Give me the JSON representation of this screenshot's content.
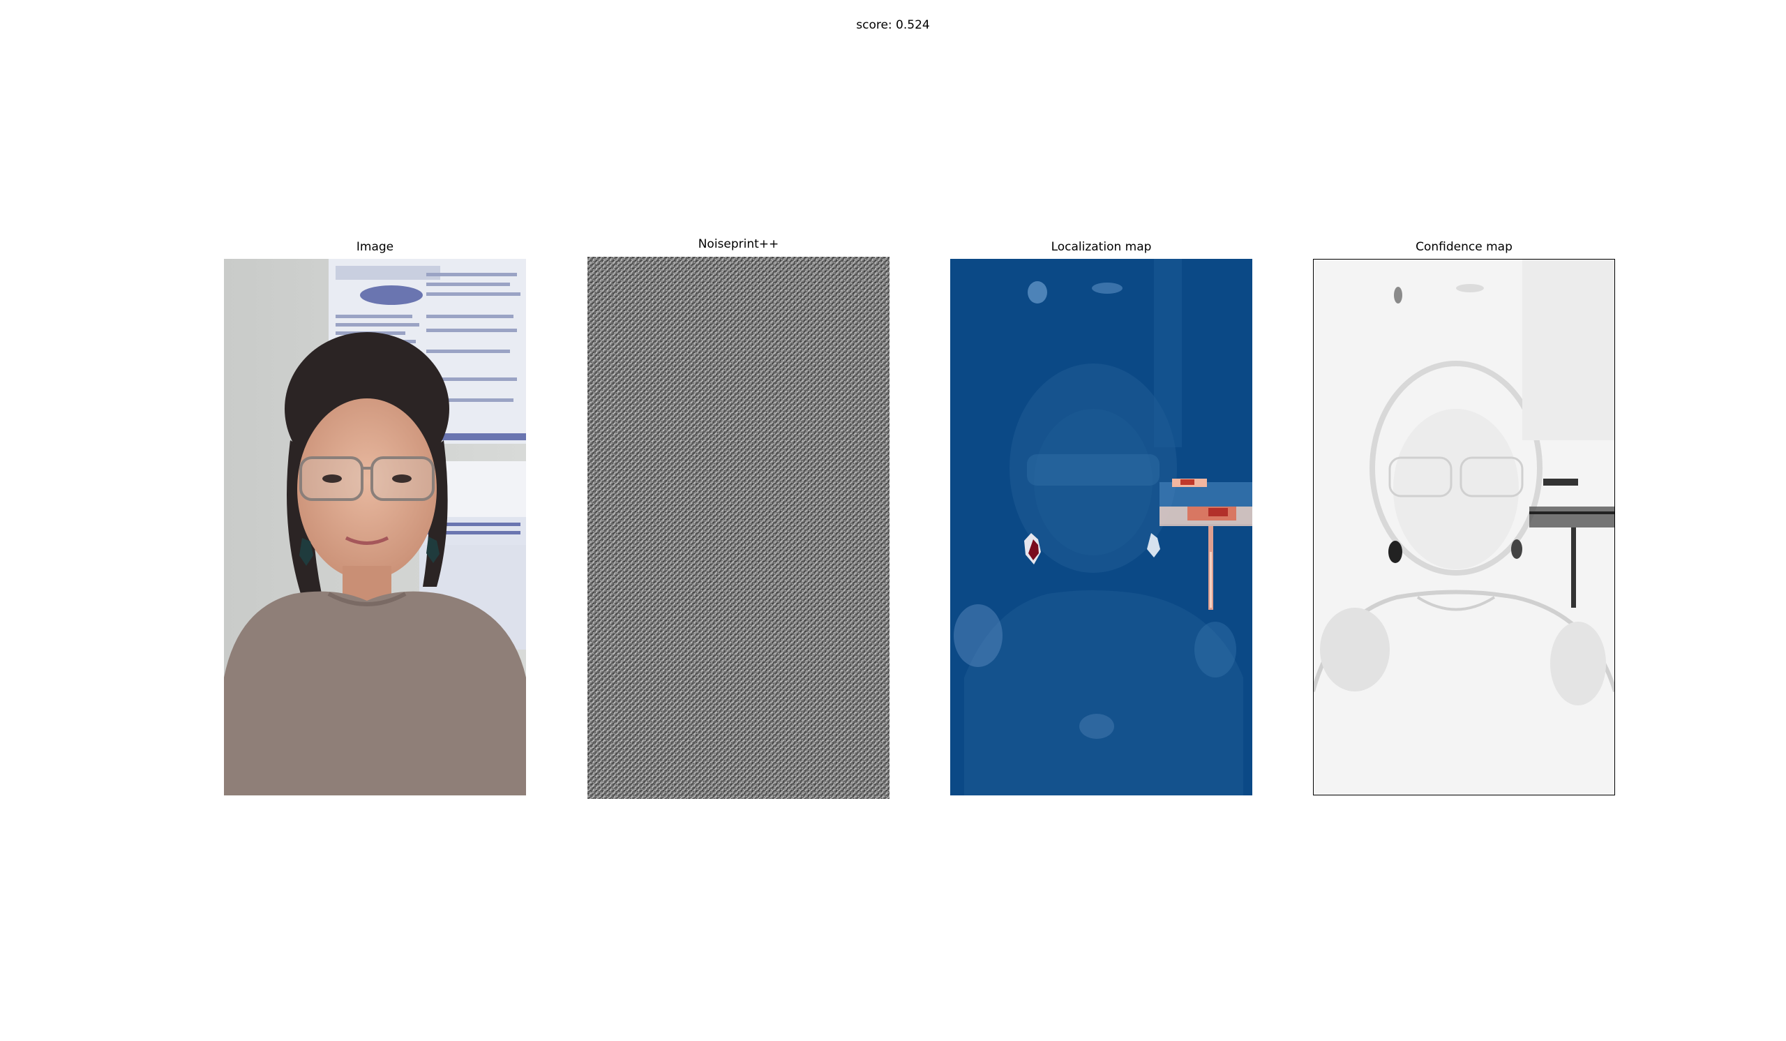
{
  "figure": {
    "score_text": "score: 0.524"
  },
  "panels": [
    {
      "title": "Image"
    },
    {
      "title": "Noiseprint++"
    },
    {
      "title": "Localization map"
    },
    {
      "title": "Confidence map"
    }
  ],
  "colors": {
    "background": "#ffffff",
    "localization_base": "#0d4d8c",
    "localization_hot": "#c0392b",
    "localization_peak": "#7a0b1f",
    "noise_gray": "#7a7a7a",
    "confidence_base": "#f4f4f4",
    "confidence_dark": "#222222"
  }
}
